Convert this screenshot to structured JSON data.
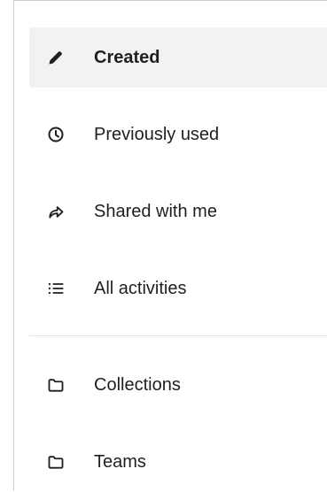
{
  "nav": {
    "items": [
      {
        "label": "Created",
        "icon": "pencil-icon",
        "active": true
      },
      {
        "label": "Previously used",
        "icon": "clock-icon",
        "active": false
      },
      {
        "label": "Shared with me",
        "icon": "share-arrow-icon",
        "active": false
      },
      {
        "label": "All activities",
        "icon": "list-icon",
        "active": false
      }
    ]
  },
  "groups": {
    "items": [
      {
        "label": "Collections",
        "icon": "folder-icon"
      },
      {
        "label": "Teams",
        "icon": "folder-icon"
      }
    ]
  },
  "colors": {
    "active_background": "#f2f2f2",
    "text": "#1f1f1f",
    "divider": "#e3e3e3"
  }
}
